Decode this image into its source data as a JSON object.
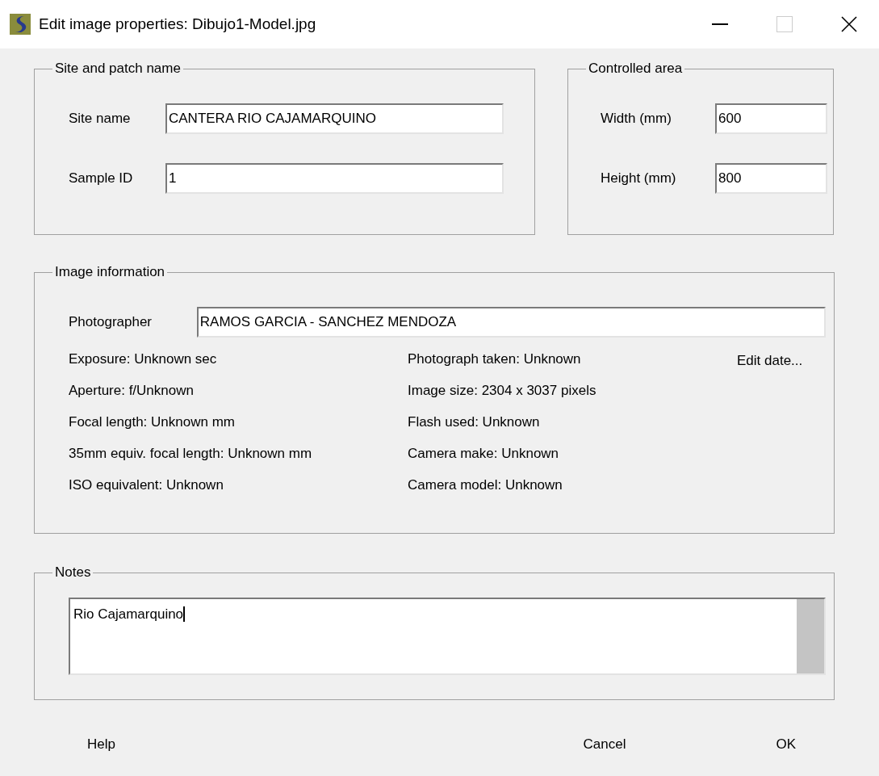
{
  "window": {
    "title": "Edit image properties: Dibujo1-Model.jpg"
  },
  "site_group": {
    "legend": "Site and patch name",
    "fields": [
      {
        "label": "Site name",
        "value": "CANTERA RIO CAJAMARQUINO"
      },
      {
        "label": "Sample ID",
        "value": "1"
      }
    ]
  },
  "area_group": {
    "legend": "Controlled area",
    "fields": [
      {
        "label": "Width (mm)",
        "value": "600"
      },
      {
        "label": "Height (mm)",
        "value": "800"
      }
    ]
  },
  "image_group": {
    "legend": "Image information",
    "photographer": {
      "label": "Photographer",
      "value": "RAMOS GARCIA - SANCHEZ MENDOZA"
    },
    "left": [
      "Exposure: Unknown sec",
      "Aperture: f/Unknown",
      "Focal length: Unknown mm",
      "35mm equiv. focal length: Unknown mm",
      "ISO equivalent: Unknown"
    ],
    "right": [
      "Photograph taken: Unknown",
      "Image size: 2304 x 3037 pixels",
      "Flash used: Unknown",
      "Camera make: Unknown",
      "Camera model: Unknown"
    ],
    "edit_date": "Edit date..."
  },
  "notes_group": {
    "legend": "Notes",
    "value": "Rio Cajamarquino"
  },
  "buttons": [
    "Help",
    "Cancel",
    "OK"
  ]
}
